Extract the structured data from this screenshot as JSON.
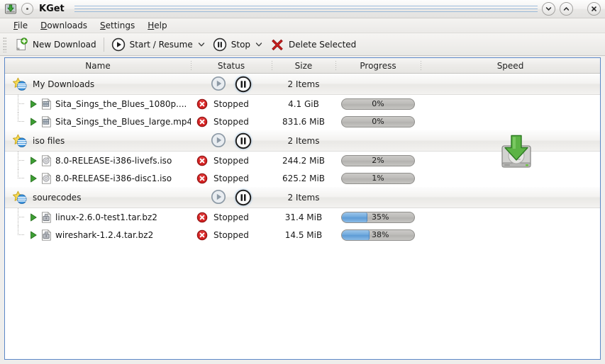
{
  "window": {
    "title": "KGet",
    "app_icon": "kget-download-icon",
    "window_menu_icon": "window-menu-dot-icon",
    "buttons": [
      {
        "name": "shade-button",
        "icon": "chevron-down-icon"
      },
      {
        "name": "unshade-button",
        "icon": "chevron-up-icon"
      },
      {
        "name": "close-button",
        "icon": "close-x-icon"
      }
    ]
  },
  "menubar": {
    "items": [
      {
        "label": "File",
        "accel": "F"
      },
      {
        "label": "Downloads",
        "accel": "D"
      },
      {
        "label": "Settings",
        "accel": "S"
      },
      {
        "label": "Help",
        "accel": "H"
      }
    ]
  },
  "toolbar": {
    "new_download": {
      "label": "New Download",
      "icon": "document-new-plus-icon"
    },
    "start_resume": {
      "label": "Start / Resume",
      "icon": "media-play-icon",
      "has_dropdown": true
    },
    "stop": {
      "label": "Stop",
      "icon": "media-pause-icon",
      "has_dropdown": true
    },
    "delete": {
      "label": "Delete Selected",
      "icon": "delete-x-icon"
    },
    "dropdown_icon": "chevron-down-icon"
  },
  "list": {
    "columns": [
      {
        "label": "Name"
      },
      {
        "label": "Status"
      },
      {
        "label": "Size"
      },
      {
        "label": "Progress"
      },
      {
        "label": "Speed"
      }
    ],
    "speed_watermark_icon": "hard-drive-download-icon",
    "groups": [
      {
        "name": "My Downloads",
        "icon": "group-star-icon",
        "count_label": "2 Items",
        "start_icon": "media-play-icon",
        "start_enabled": false,
        "pause_icon": "media-pause-icon",
        "pause_active": true,
        "items": [
          {
            "name": "Sita_Sings_the_Blues_1080p....",
            "file_icon": "video-file-icon",
            "expander_icon": "expander-arrow-icon",
            "status_icon": "stopped-error-icon",
            "status": "Stopped",
            "size": "4.1 GiB",
            "progress_text": "0%",
            "progress_value": 0,
            "speed": ""
          },
          {
            "name": "Sita_Sings_the_Blues_large.mp4",
            "file_icon": "video-file-icon",
            "expander_icon": "expander-arrow-icon",
            "status_icon": "stopped-error-icon",
            "status": "Stopped",
            "size": "831.6 MiB",
            "progress_text": "0%",
            "progress_value": 0,
            "speed": ""
          }
        ]
      },
      {
        "name": "iso files",
        "icon": "group-star-icon",
        "count_label": "2 Items",
        "start_icon": "media-play-icon",
        "start_enabled": false,
        "pause_icon": "media-pause-icon",
        "pause_active": true,
        "items": [
          {
            "name": "8.0-RELEASE-i386-livefs.iso",
            "file_icon": "disc-image-file-icon",
            "expander_icon": "expander-arrow-icon",
            "status_icon": "stopped-error-icon",
            "status": "Stopped",
            "size": "244.2 MiB",
            "progress_text": "2%",
            "progress_value": 0,
            "speed": ""
          },
          {
            "name": "8.0-RELEASE-i386-disc1.iso",
            "file_icon": "disc-image-file-icon",
            "expander_icon": "expander-arrow-icon",
            "status_icon": "stopped-error-icon",
            "status": "Stopped",
            "size": "625.2 MiB",
            "progress_text": "1%",
            "progress_value": 0,
            "speed": ""
          }
        ]
      },
      {
        "name": "sourecodes",
        "icon": "group-star-icon",
        "count_label": "2 Items",
        "start_icon": "media-play-icon",
        "start_enabled": false,
        "pause_icon": "media-pause-icon",
        "pause_active": true,
        "items": [
          {
            "name": "linux-2.6.0-test1.tar.bz2",
            "file_icon": "archive-file-icon",
            "expander_icon": "expander-arrow-icon",
            "status_icon": "stopped-error-icon",
            "status": "Stopped",
            "size": "31.4 MiB",
            "progress_text": "35%",
            "progress_value": 35,
            "speed": ""
          },
          {
            "name": "wireshark-1.2.4.tar.bz2",
            "file_icon": "archive-file-icon",
            "expander_icon": "expander-arrow-icon",
            "status_icon": "stopped-error-icon",
            "status": "Stopped",
            "size": "14.5 MiB",
            "progress_text": "38%",
            "progress_value": 38,
            "speed": ""
          }
        ]
      }
    ]
  },
  "colors": {
    "focus_border": "#5b87c7",
    "progress_fill": "#6fa9dd",
    "error_red": "#cc1f1f",
    "play_green": "#37a032",
    "star_yellow": "#f5d649",
    "accent_blue": "#6c9ed0"
  }
}
